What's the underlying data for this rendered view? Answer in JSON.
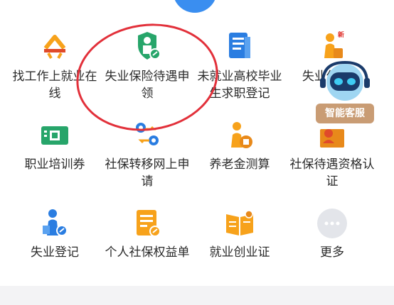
{
  "colors": {
    "accent_blue": "#3a8ef0",
    "icon_orange": "#f7a21b",
    "icon_green": "#27a56a",
    "icon_blue": "#2a7de1",
    "icon_gray": "#e3e5ea",
    "annotation_red": "#e2303a"
  },
  "services": [
    {
      "label": "找工作上就业在线",
      "icon": "job-search-icon"
    },
    {
      "label": "失业保险待遇申领",
      "icon": "unemployment-insurance-icon"
    },
    {
      "label": "未就业高校毕业生求职登记",
      "icon": "graduate-registration-icon"
    },
    {
      "label": "失业保险...",
      "icon": "new-badge-person-icon"
    },
    {
      "label": "职业培训券",
      "icon": "training-voucher-icon"
    },
    {
      "label": "社保转移网上申请",
      "icon": "transfer-location-icon"
    },
    {
      "label": "养老金测算",
      "icon": "pension-calculator-icon"
    },
    {
      "label": "社保待遇资格认证",
      "icon": "qualification-cert-icon"
    },
    {
      "label": "失业登记",
      "icon": "unemployment-registration-icon"
    },
    {
      "label": "个人社保权益单",
      "icon": "social-security-statement-icon"
    },
    {
      "label": "就业创业证",
      "icon": "employment-certificate-icon"
    },
    {
      "label": "更多",
      "icon": "more-icon"
    }
  ],
  "customer_service": {
    "label": "智能客服",
    "icon": "robot-assistant-icon"
  }
}
